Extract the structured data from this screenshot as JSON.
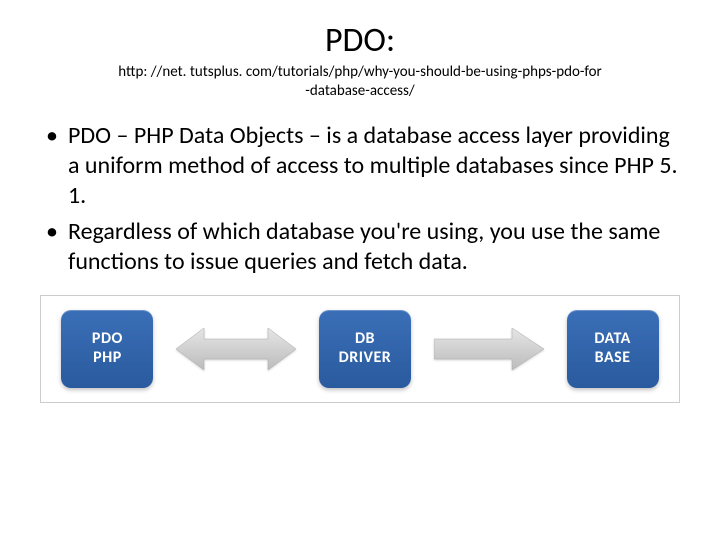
{
  "title": "PDO:",
  "subtitle_line1": "http: //net. tutsplus. com/tutorials/php/why-you-should-be-using-phps-pdo-for",
  "subtitle_line2": "-database-access/",
  "bullets": [
    "PDO – PHP Data Objects – is a database access layer providing a uniform method of access to multiple databases since PHP 5. 1.",
    "Regardless of which database you're using, you use the same functions to issue queries and fetch data."
  ],
  "diagram": {
    "node1_line1": "PDO",
    "node1_line2": "PHP",
    "node2_line1": "DB",
    "node2_line2": "DRIVER",
    "node3_line1": "DATA",
    "node3_line2": "BASE"
  }
}
